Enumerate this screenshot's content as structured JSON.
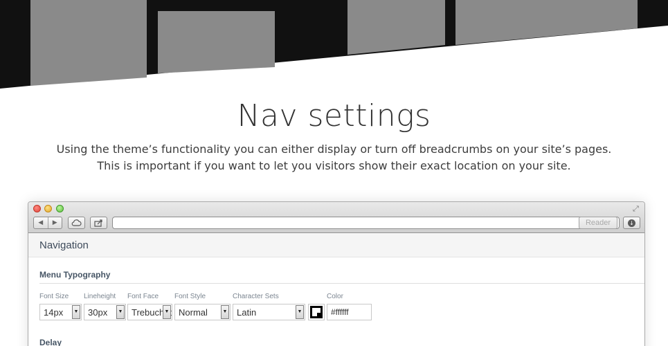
{
  "hero": {
    "bg_color": "#111111",
    "tile_color": "#8a8a8a"
  },
  "heading": {
    "title": "Nav settings",
    "subtitle_line1": "Using the theme’s functionality you can either display or turn off breadcrumbs on your site’s pages.",
    "subtitle_line2": "This is important if you want to let you visitors show their exact location on your site."
  },
  "browser": {
    "toolbar": {
      "back_icon": "back-arrow-icon",
      "forward_icon": "forward-arrow-icon",
      "cloud_icon": "icloud-tabs-icon",
      "share_icon": "share-icon",
      "url_value": "",
      "reload_icon": "reload-icon",
      "reader_label": "Reader",
      "downloads_icon": "downloads-icon"
    },
    "page": {
      "header_title": "Navigation",
      "menu_section": "Menu Typography",
      "fields": {
        "font_size": {
          "label": "Font Size",
          "value": "14px"
        },
        "lineheight": {
          "label": "Lineheight",
          "value": "30px"
        },
        "font_face": {
          "label": "Font Face",
          "value": "Trebuchet"
        },
        "font_style": {
          "label": "Font Style",
          "value": "Normal"
        },
        "charset": {
          "label": "Character Sets",
          "value": "Latin"
        },
        "color": {
          "label": "Color",
          "value": "#ffffff"
        }
      },
      "delay_section": "Delay"
    }
  }
}
